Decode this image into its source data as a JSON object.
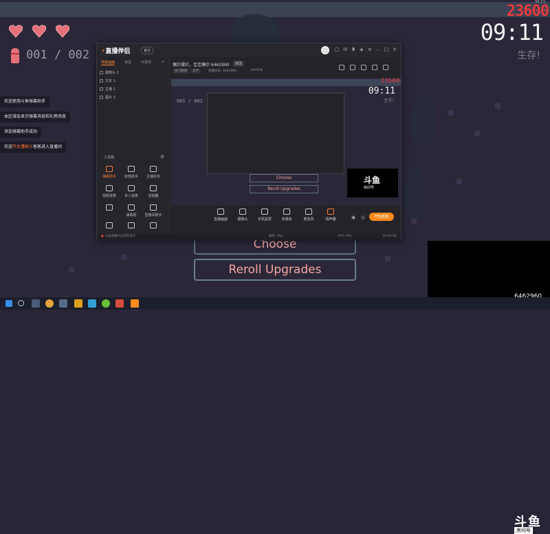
{
  "game": {
    "score": "23600",
    "score_small": "98.1%",
    "timer": "09:11",
    "survive_label": "生存!",
    "ammo_count": "001 / 002",
    "hearts": 3,
    "choose_label": "Choose",
    "reroll_label": "Reroll Upgrades"
  },
  "chat": [
    {
      "text": "欢迎使用斗鱼弹幕助手"
    },
    {
      "text": "本区域会显示弹幕消息和礼物消息"
    },
    {
      "text": "添加弹幕助手成功"
    },
    {
      "pre": "欢迎",
      "highlight": "不太懂绅士",
      "post": "客客进入直播间"
    }
  ],
  "app": {
    "logo": "直播伴侣",
    "version": "官方",
    "sidebar_tabs": [
      "场景画面",
      "双击",
      "可发布"
    ],
    "scene_items": [
      "摄像头 2",
      "文本 1",
      "主播 1",
      "图片 2"
    ],
    "toolbox_title": "工具箱",
    "tools": [
      {
        "label": "弹幕助手",
        "orange": true
      },
      {
        "label": "房管助手",
        "orange": false
      },
      {
        "label": "主播任务",
        "orange": false
      },
      {
        "label": "视频连麦",
        "orange": false
      },
      {
        "label": "多人连麦",
        "orange": false
      },
      {
        "label": "滤镜器",
        "orange": false
      },
      {
        "label": "",
        "orange": false
      },
      {
        "label": "弹幕姬",
        "orange": false
      },
      {
        "label": "直播间助手",
        "orange": false
      },
      {
        "label": "",
        "orange": false
      },
      {
        "label": "",
        "orange": false
      },
      {
        "label": "",
        "orange": false
      }
    ],
    "stream_title": "偶尔摆烂，佳佳偶尔 6462960",
    "stream_edit": "修改",
    "tags": [
      "热门游戏",
      "大厅"
    ],
    "room_info": "直播间号: 6462960",
    "viewer_count": "697646",
    "controls": [
      "直播画面",
      "摄像头",
      "手机投屏",
      "多媒体",
      "麦克风",
      "扬声器"
    ],
    "start_label": "开始直播",
    "status_left": "斗鱼直播中出现的首页",
    "status_time": "00:00:00",
    "status_bitrate": "帧率: 0fps",
    "status_cpu": "CPU 49%"
  },
  "watermark": {
    "brand": "斗鱼",
    "sub": "房间号",
    "room": "6462960"
  }
}
